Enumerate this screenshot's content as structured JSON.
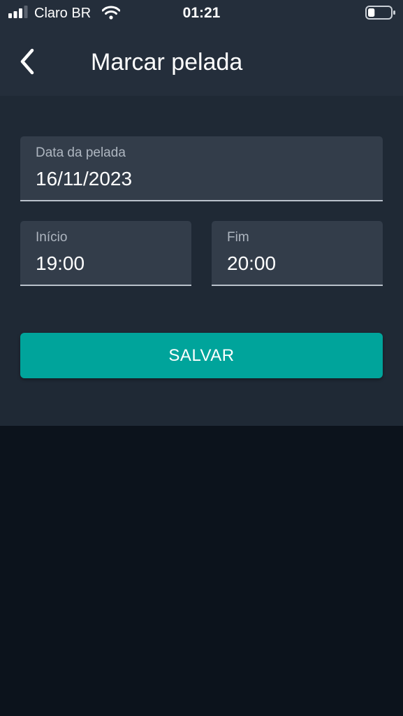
{
  "status_bar": {
    "carrier": "Claro BR",
    "time": "01:21",
    "signal_bars": 3,
    "signal_bars_total": 4,
    "battery_level": 0.3,
    "icons": [
      "signal-icon",
      "wifi-icon",
      "battery-icon"
    ]
  },
  "header": {
    "title": "Marcar pelada",
    "back_icon": "chevron-left-icon"
  },
  "form": {
    "date": {
      "label": "Data da pelada",
      "value": "16/11/2023"
    },
    "start": {
      "label": "Início",
      "value": "19:00"
    },
    "end": {
      "label": "Fim",
      "value": "20:00"
    },
    "save_label": "SALVAR"
  },
  "colors": {
    "accent": "#00a49b",
    "header_bg": "#242e3b",
    "panel_bg": "#1f2935",
    "field_bg": "#333d4a",
    "page_bg": "#0c131c"
  }
}
